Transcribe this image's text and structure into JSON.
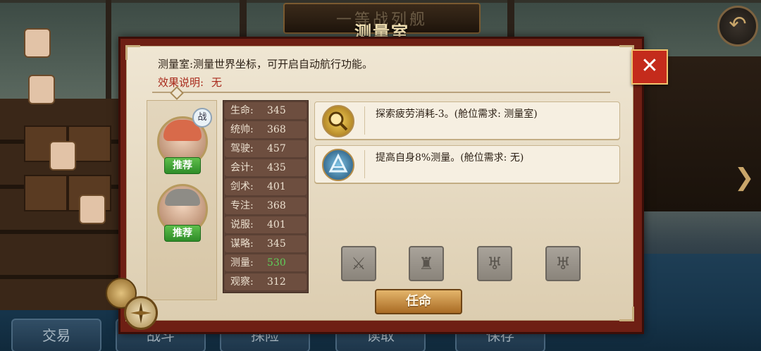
{
  "header": {
    "subtitle": "一等战列舰",
    "title": "测量室"
  },
  "icons": {
    "back": "back-arrow-icon",
    "next": "right-arrow-icon",
    "close": "close-icon",
    "compass": "compass-icon"
  },
  "bottom_nav": [
    {
      "label": "交易"
    },
    {
      "label": "战斗"
    },
    {
      "label": "探险"
    },
    {
      "label": "读取"
    },
    {
      "label": "保存"
    }
  ],
  "dialog": {
    "description": "测量室:测量世界坐标，可开启自动航行功能。",
    "effect_label": "效果说明:",
    "effect_value": "无",
    "close_label": "✕",
    "portraits": [
      {
        "badge": "推荐",
        "tag": "战"
      },
      {
        "badge": "推荐"
      }
    ],
    "stats": [
      {
        "name": "生命:",
        "value": "345"
      },
      {
        "name": "统帅:",
        "value": "368"
      },
      {
        "name": "驾驶:",
        "value": "457"
      },
      {
        "name": "会计:",
        "value": "435"
      },
      {
        "name": "剑术:",
        "value": "401"
      },
      {
        "name": "专注:",
        "value": "368"
      },
      {
        "name": "说服:",
        "value": "401"
      },
      {
        "name": "谋略:",
        "value": "345"
      },
      {
        "name": "测量:",
        "value": "530"
      },
      {
        "name": "观察:",
        "value": "312"
      }
    ],
    "skills": [
      {
        "icon": "magnifier-icon",
        "text": "探索疲劳消耗-3。(舱位需求: 测量室)"
      },
      {
        "icon": "sextant-icon",
        "text": "提高自身8%测量。(舱位需求: 无)"
      }
    ],
    "equipment_slots": [
      "sword-icon",
      "armor-icon",
      "cup-icon",
      "cup-icon"
    ],
    "appoint_label": "任命"
  },
  "colors": {
    "dialog_frame": "#6e1f14",
    "paper": "#efe6d3",
    "effect_text": "#a8291b",
    "highlight_stat": "#5fd05a",
    "badge_green": "#2e8c28",
    "appoint_button": "#c98f42"
  }
}
